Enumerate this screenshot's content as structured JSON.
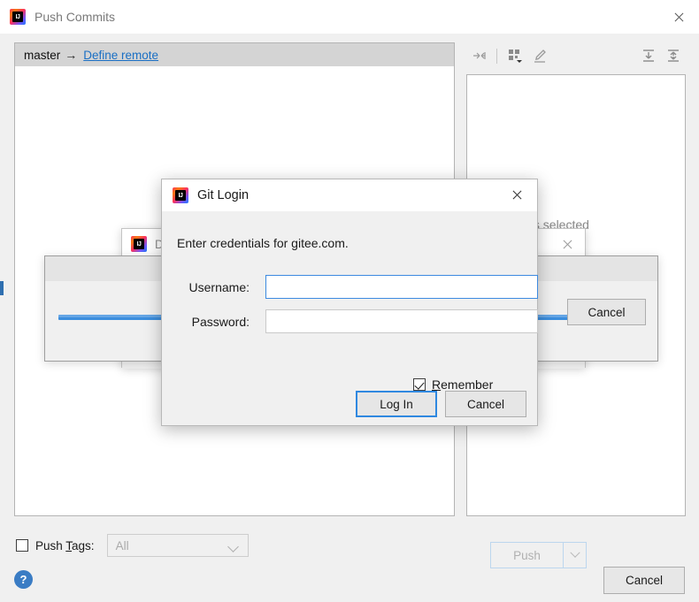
{
  "window": {
    "title": "Push Commits",
    "icon": "intellij-idea-icon",
    "close_label": "close-icon"
  },
  "left_panel": {
    "branch_source": "master",
    "arrow": "→",
    "define_remote_link": "Define remote"
  },
  "right_panel": {
    "empty_text": "No commits selected",
    "toolbar": [
      {
        "name": "collapse-to-left-icon",
        "title": ""
      },
      {
        "name": "group-by-icon",
        "title": ""
      },
      {
        "name": "edit-pencil-icon",
        "title": ""
      },
      {
        "name": "expand-all-icon",
        "title": ""
      },
      {
        "name": "collapse-all-icon",
        "title": ""
      }
    ]
  },
  "bottom": {
    "push_tags_label_pre": "Push ",
    "push_tags_label_mnemonic": "T",
    "push_tags_label_post": "ags:",
    "push_tags_checked": false,
    "tags_combo_value": "All",
    "help_label": "?",
    "push_button": "Push",
    "push_dropdown": "chevron-down-icon",
    "cancel_button": "Cancel"
  },
  "background_dialog": {
    "title_prefix": "D",
    "icon": "intellij-idea-icon",
    "close_label": "close-icon"
  },
  "progress_dialog": {
    "cancel_button": "Cancel",
    "progress_percent": 84
  },
  "git_login": {
    "title": "Git Login",
    "icon": "intellij-idea-icon",
    "close_label": "close-icon",
    "message": "Enter credentials for gitee.com.",
    "username_label": "Username:",
    "username_value": "",
    "password_label": "Password:",
    "password_value": "",
    "remember_label_mnemonic": "R",
    "remember_label_rest": "emember",
    "remember_checked": true,
    "login_button": "Log In",
    "cancel_button": "Cancel"
  },
  "colors": {
    "accent_blue": "#3d8ae0",
    "link_blue": "#1a6fc4",
    "progress_blue": "#3c8ede",
    "window_bg": "#f0f0f0",
    "panel_bg": "#ffffff",
    "branch_row_bg": "#d4d4d4"
  }
}
